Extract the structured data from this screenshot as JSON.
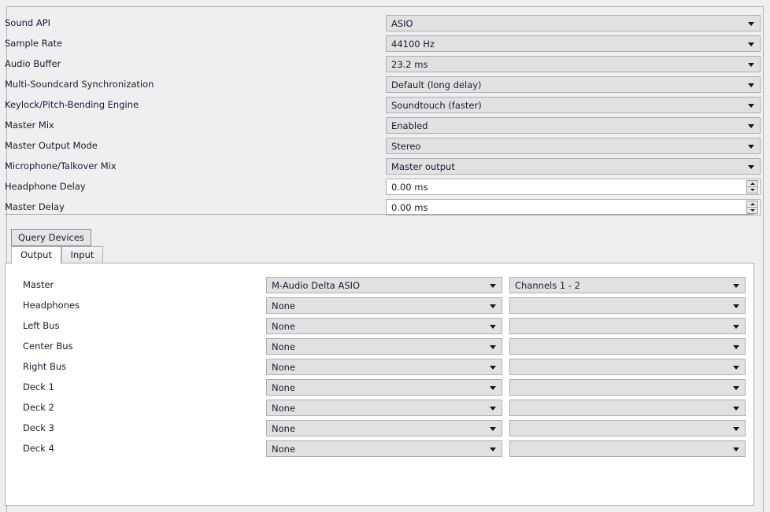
{
  "settings": {
    "rows": [
      {
        "label": "Sound API",
        "control": "combo",
        "value": "ASIO"
      },
      {
        "label": "Sample Rate",
        "control": "combo",
        "value": "44100 Hz"
      },
      {
        "label": "Audio Buffer",
        "control": "combo",
        "value": "23.2 ms"
      },
      {
        "label": "Multi-Soundcard Synchronization",
        "control": "combo",
        "value": "Default (long delay)"
      },
      {
        "label": "Keylock/Pitch-Bending Engine",
        "control": "combo",
        "value": "Soundtouch (faster)"
      },
      {
        "label": "Master Mix",
        "control": "combo",
        "value": "Enabled"
      },
      {
        "label": "Master Output Mode",
        "control": "combo",
        "value": "Stereo"
      },
      {
        "label": "Microphone/Talkover Mix",
        "control": "combo",
        "value": "Master output"
      },
      {
        "label": "Headphone Delay",
        "control": "spin",
        "value": "0.00 ms"
      },
      {
        "label": "Master Delay",
        "control": "spin",
        "value": "0.00 ms"
      }
    ]
  },
  "actions": {
    "query_devices_label": "Query Devices"
  },
  "tabs": {
    "items": [
      {
        "label": "Output",
        "active": true
      },
      {
        "label": "Input",
        "active": false
      }
    ]
  },
  "devices": {
    "rows": [
      {
        "label": "Master",
        "device": "M-Audio Delta ASIO",
        "channels": "Channels 1 - 2"
      },
      {
        "label": "Headphones",
        "device": "None",
        "channels": ""
      },
      {
        "label": "Left Bus",
        "device": "None",
        "channels": ""
      },
      {
        "label": "Center Bus",
        "device": "None",
        "channels": ""
      },
      {
        "label": "Right Bus",
        "device": "None",
        "channels": ""
      },
      {
        "label": "Deck 1",
        "device": "None",
        "channels": ""
      },
      {
        "label": "Deck 2",
        "device": "None",
        "channels": ""
      },
      {
        "label": "Deck 3",
        "device": "None",
        "channels": ""
      },
      {
        "label": "Deck 4",
        "device": "None",
        "channels": ""
      }
    ]
  },
  "icons": {
    "dropdown": "chevron-down-icon",
    "spin_up": "spinner-up-icon",
    "spin_down": "spinner-down-icon"
  },
  "colors": {
    "window_bg": "#efefef",
    "combo_bg": "#e1e1e1",
    "panel_bg": "#ffffff",
    "border": "#aeaeae",
    "text": "#1b1b2b"
  }
}
